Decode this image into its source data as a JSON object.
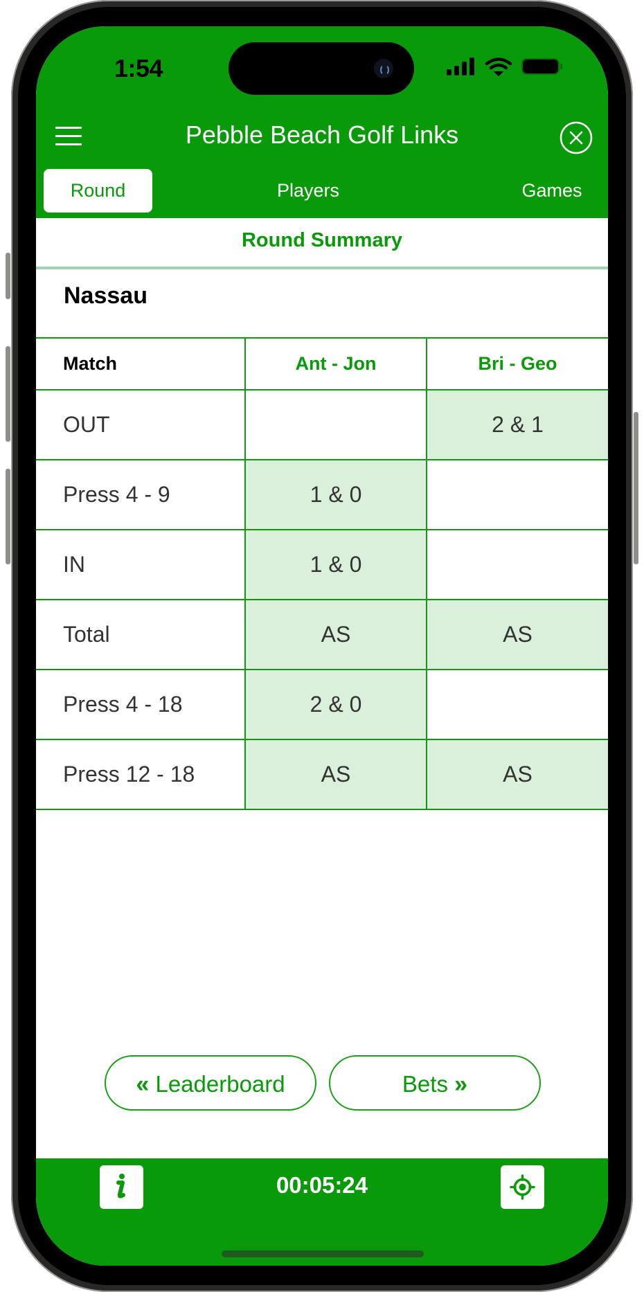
{
  "status_bar": {
    "time": "1:54",
    "icons": [
      "signal-icon",
      "wifi-icon",
      "battery-icon"
    ]
  },
  "header": {
    "title": "Pebble Beach Golf Links",
    "menu_icon": "hamburger-menu-icon",
    "close_icon": "close-circle-icon"
  },
  "tabs": [
    {
      "label": "Round",
      "active": true
    },
    {
      "label": "Players",
      "active": false
    },
    {
      "label": "Games",
      "active": false
    }
  ],
  "summary": {
    "title": "Round Summary"
  },
  "game": {
    "name": "Nassau",
    "table": {
      "headers": [
        "Match",
        "Ant - Jon",
        "Bri - Geo"
      ],
      "rows": [
        {
          "label": "OUT",
          "values": [
            "",
            "2 & 1"
          ],
          "highlight": [
            false,
            true
          ]
        },
        {
          "label": "Press 4 - 9",
          "values": [
            "1 & 0",
            ""
          ],
          "highlight": [
            true,
            false
          ]
        },
        {
          "label": "IN",
          "values": [
            "1 & 0",
            ""
          ],
          "highlight": [
            true,
            false
          ]
        },
        {
          "label": "Total",
          "values": [
            "AS",
            "AS"
          ],
          "highlight": [
            true,
            true
          ]
        },
        {
          "label": "Press 4 - 18",
          "values": [
            "2 & 0",
            ""
          ],
          "highlight": [
            true,
            false
          ]
        },
        {
          "label": "Press 12 - 18",
          "values": [
            "AS",
            "AS"
          ],
          "highlight": [
            true,
            true
          ]
        }
      ]
    }
  },
  "nav_buttons": {
    "prev": {
      "label": "Leaderboard",
      "icon": "double-chevron-left-icon",
      "glyph": "«"
    },
    "next": {
      "label": "Bets",
      "icon": "double-chevron-right-icon",
      "glyph": "»"
    }
  },
  "footer": {
    "timer": "00:05:24",
    "info_icon": "info-icon",
    "locate_icon": "locate-icon"
  },
  "colors": {
    "brand_green": "#089a08",
    "win_cell": "#daf0da",
    "divider": "#9ed4b0"
  }
}
